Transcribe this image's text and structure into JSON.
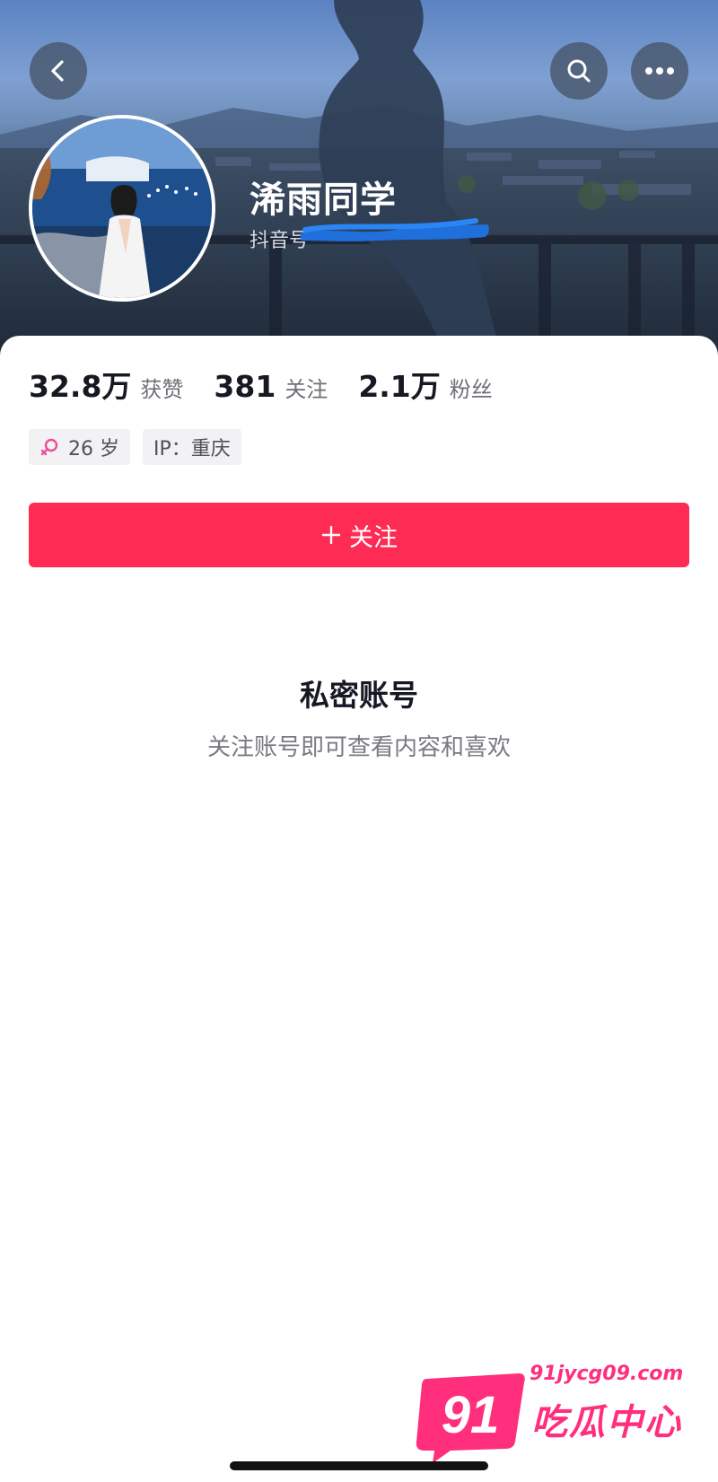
{
  "profile": {
    "nickname": "浠雨同学",
    "id_prefix": "抖音号",
    "avatar_alt": "avatar"
  },
  "stats": [
    {
      "value": "32.8万",
      "label": "获赞"
    },
    {
      "value": "381",
      "label": "关注"
    },
    {
      "value": "2.1万",
      "label": "粉丝"
    }
  ],
  "tags": {
    "age": "26 岁",
    "ip": "IP：重庆"
  },
  "actions": {
    "follow_label": "关注"
  },
  "private_notice": {
    "title": "私密账号",
    "description": "关注账号即可查看内容和喜欢"
  },
  "watermark": {
    "number": "91",
    "url": "91jycg09.com",
    "name": "吃瓜中心"
  },
  "icons": {
    "back": "chevron-left-icon",
    "search": "search-icon",
    "more": "more-dots-icon",
    "gender": "female-icon",
    "follow": "plus-icon"
  },
  "colors": {
    "accent": "#fe2c55",
    "watermark": "#ff2f7d",
    "text_primary": "#161823",
    "text_secondary": "#6f6f77"
  }
}
